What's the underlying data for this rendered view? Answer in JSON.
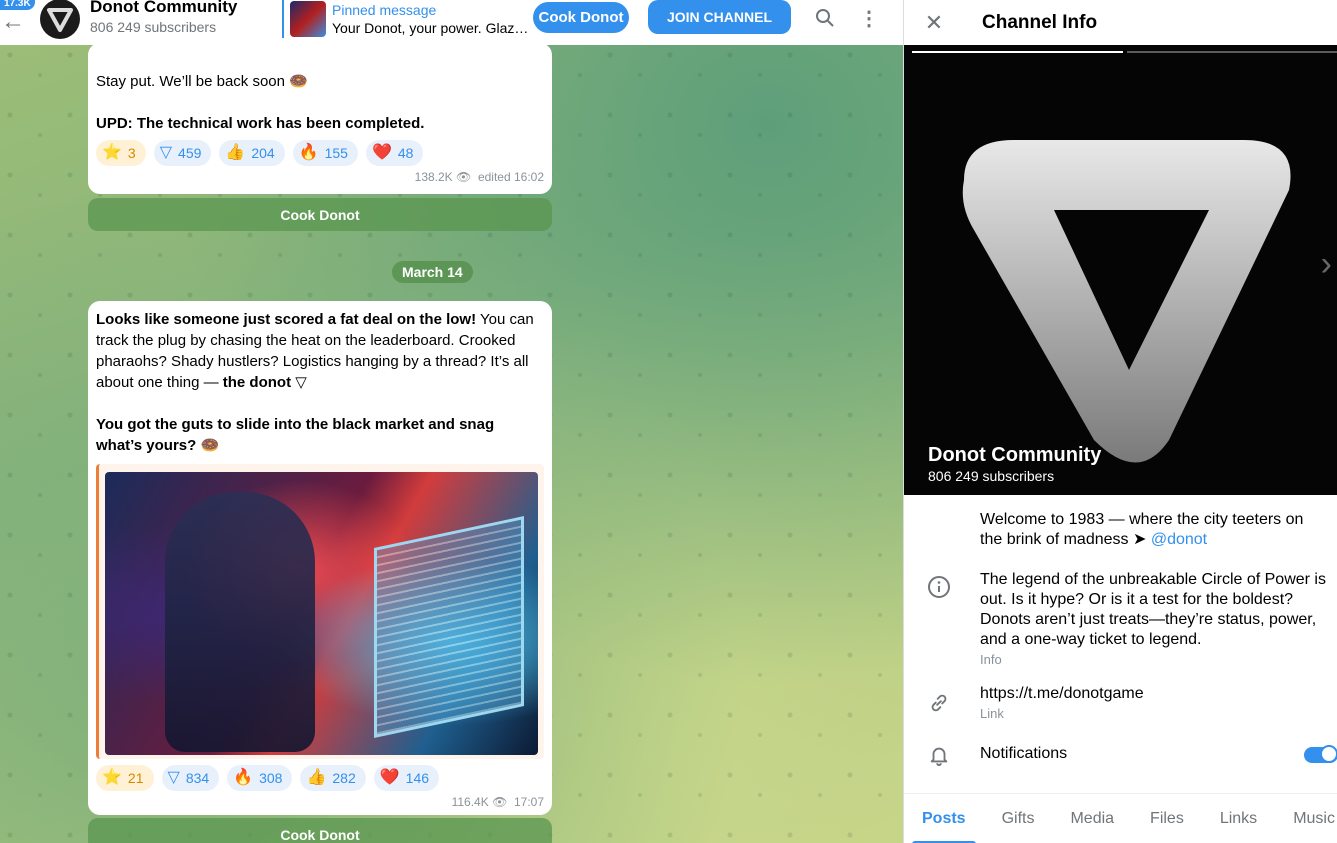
{
  "header": {
    "back_icon": "arrow-left-icon",
    "unread_badge": "17.3K",
    "title": "Donot Community",
    "subtitle": "806 249 subscribers",
    "pinned_label": "Pinned message",
    "pinned_text": "Your Donot, your power. Glaze,...",
    "cook_button": "Cook Donot",
    "join_button": "JOIN CHANNEL",
    "search_icon": "search-icon",
    "more_icon": "more-vertical-icon"
  },
  "messages": [
    {
      "line1": "Stay put. We’ll be back soon",
      "line1_emoji": "🍩",
      "line2": "UPD: The technical work has been completed.",
      "reactions": [
        {
          "emoji": "⭐",
          "count": "3"
        },
        {
          "emoji": "▽",
          "count": "459"
        },
        {
          "emoji": "👍",
          "count": "204"
        },
        {
          "emoji": "🔥",
          "count": "155"
        },
        {
          "emoji": "❤️",
          "count": "48"
        }
      ],
      "views": "138.2K",
      "time": "edited 16:02",
      "button": "Cook Donot"
    },
    {
      "date": "March 14",
      "p1_bold": "Looks like someone just scored a fat deal on the low!",
      "p1_rest": " You can track the plug by chasing the heat on the leaderboard. Crooked pharaohs? Shady hustlers? Logistics hanging by a thread? It’s all about one thing — ",
      "p1_end_bold": "the donot",
      "p1_icon": "▽",
      "p2_bold": "You got the guts to slide into the black market and snag what’s yours?",
      "p2_emoji": "🍩",
      "reactions": [
        {
          "emoji": "⭐",
          "count": "21"
        },
        {
          "emoji": "▽",
          "count": "834"
        },
        {
          "emoji": "🔥",
          "count": "308"
        },
        {
          "emoji": "👍",
          "count": "282"
        },
        {
          "emoji": "❤️",
          "count": "146"
        }
      ],
      "views": "116.4K",
      "time": "17:07",
      "button": "Cook Donot"
    }
  ],
  "info": {
    "title": "Channel Info",
    "close_icon": "close-icon",
    "photo_name": "Donot Community",
    "photo_subs": "806 249 subscribers",
    "welcome_text": "Welcome to 1983 — where the city teeters on the brink of madness ➤ ",
    "welcome_link": "@donot",
    "about": "The legend of the unbreakable Circle of Power is out. Is it hype? Or is it a test for the boldest? Donots aren’t just treats—they’re status, power, and a one-way ticket to legend.",
    "about_caption": "Info",
    "link": "https://t.me/donotgame",
    "link_caption": "Link",
    "notifications": "Notifications",
    "notifications_on": true,
    "tabs": [
      "Posts",
      "Gifts",
      "Media",
      "Files",
      "Links",
      "Music"
    ],
    "active_tab": "Posts"
  }
}
